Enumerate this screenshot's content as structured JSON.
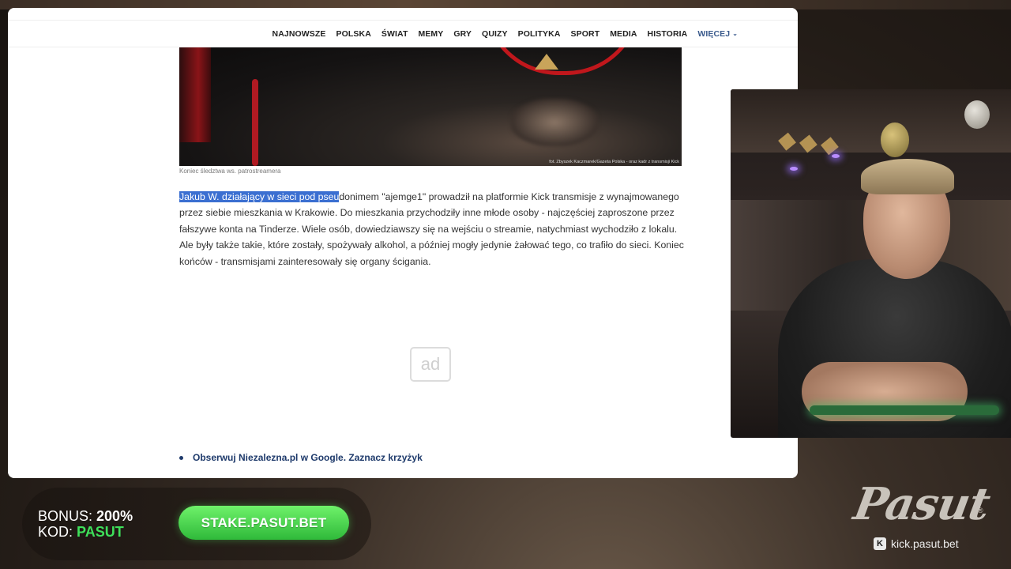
{
  "nav": {
    "items": [
      "NAJNOWSZE",
      "POLSKA",
      "ŚWIAT",
      "MEMY",
      "GRY",
      "QUIZY",
      "POLITYKA",
      "SPORT",
      "MEDIA",
      "HISTORIA"
    ],
    "more_label": "WIĘCEJ"
  },
  "photo": {
    "credit": "fot. Zbyszek Kaczmarek/Gazeta Polska - oraz kadr z transmisji Kick",
    "caption": "Koniec śledztwa ws. patrostreamera"
  },
  "article": {
    "highlighted": "Jakub W. działający w sieci pod pseu",
    "rest": "donimem \"ajemge1\" prowadził na platformie Kick transmisje z wynajmowanego przez siebie mieszkania w Krakowie. Do mieszkania przychodziły inne młode osoby - najczęściej zaproszone przez fałszywe konta na Tinderze. Wiele osób, dowiedziawszy się na wejściu o streamie, natychmiast wychodziło z lokalu. Ale były także takie, które zostały, spożywały alkohol, a później mogły jedynie żałować tego, co trafiło do sieci. Koniec końców - transmisjami zainteresowały się organy ścigania."
  },
  "ad": {
    "label": "ad"
  },
  "follow_link": "Obserwuj Niezalezna.pl w Google. Zaznacz krzyżyk",
  "overlay": {
    "bonus_label": "BONUS:",
    "bonus_value": "200%",
    "code_label": "KOD:",
    "code_value": "PASUT",
    "stake_button": "STAKE.PASUT.BET",
    "logo": "Pasut",
    "registered": "®",
    "kick_icon": "K",
    "kick_url": "kick.pasut.bet"
  },
  "colors": {
    "nav_more": "#3a5a8c",
    "highlight": "#3b6fd1",
    "link": "#1e3a6b",
    "accent_green": "#3ee05a"
  }
}
